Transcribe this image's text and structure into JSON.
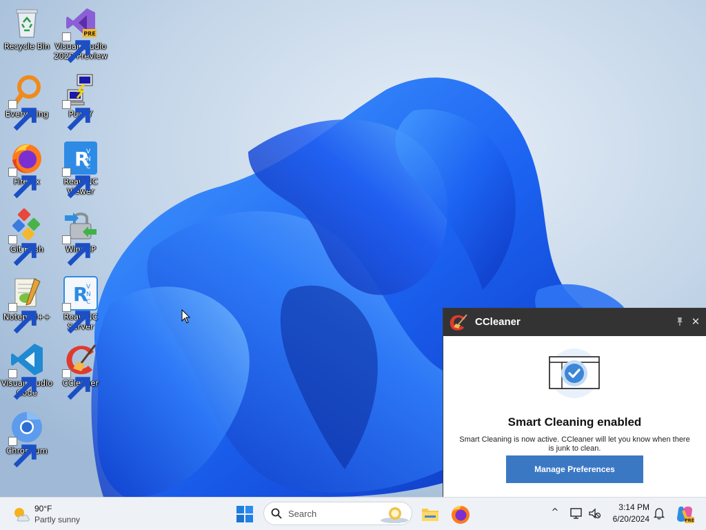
{
  "desktop": {
    "icons": [
      {
        "label": "Recycle Bin",
        "icon": "recycle-bin-icon"
      },
      {
        "label": "Visual Studio 2022 Preview",
        "icon": "visual-studio-icon",
        "badge": "PRE"
      },
      {
        "label": "Everything",
        "icon": "everything-search-icon"
      },
      {
        "label": "PuTTY",
        "icon": "putty-icon"
      },
      {
        "label": "Firefox",
        "icon": "firefox-icon"
      },
      {
        "label": "RealVNC Viewer",
        "icon": "realvnc-viewer-icon"
      },
      {
        "label": "Git Bash",
        "icon": "git-bash-icon"
      },
      {
        "label": "WinSCP",
        "icon": "winscp-icon"
      },
      {
        "label": "Notepad++",
        "icon": "notepadpp-icon"
      },
      {
        "label": "RealVNC Server",
        "icon": "realvnc-server-icon"
      },
      {
        "label": "Visual Studio Code",
        "icon": "vscode-icon"
      },
      {
        "label": "CCleaner",
        "icon": "ccleaner-icon"
      },
      {
        "label": "Chromium",
        "icon": "chromium-icon"
      }
    ]
  },
  "toast": {
    "app_name": "CCleaner",
    "heading": "Smart Cleaning enabled",
    "message": "Smart Cleaning is now active. CCleaner will let you know when there is junk to clean.",
    "button_label": "Manage Preferences",
    "colors": {
      "header": "#333333",
      "button": "#3b78c4",
      "check": "#3b86d8"
    }
  },
  "taskbar": {
    "weather": {
      "temp": "90°F",
      "condition": "Partly sunny"
    },
    "search_placeholder": "Search",
    "clock": {
      "time": "3:14 PM",
      "date": "6/20/2024"
    },
    "tray_chevron": "^"
  },
  "colors": {
    "taskbar_bg": "#eef1f5",
    "wallpaper_sky": "#b9cde1",
    "bloom_blue": "#1a5cf0"
  }
}
